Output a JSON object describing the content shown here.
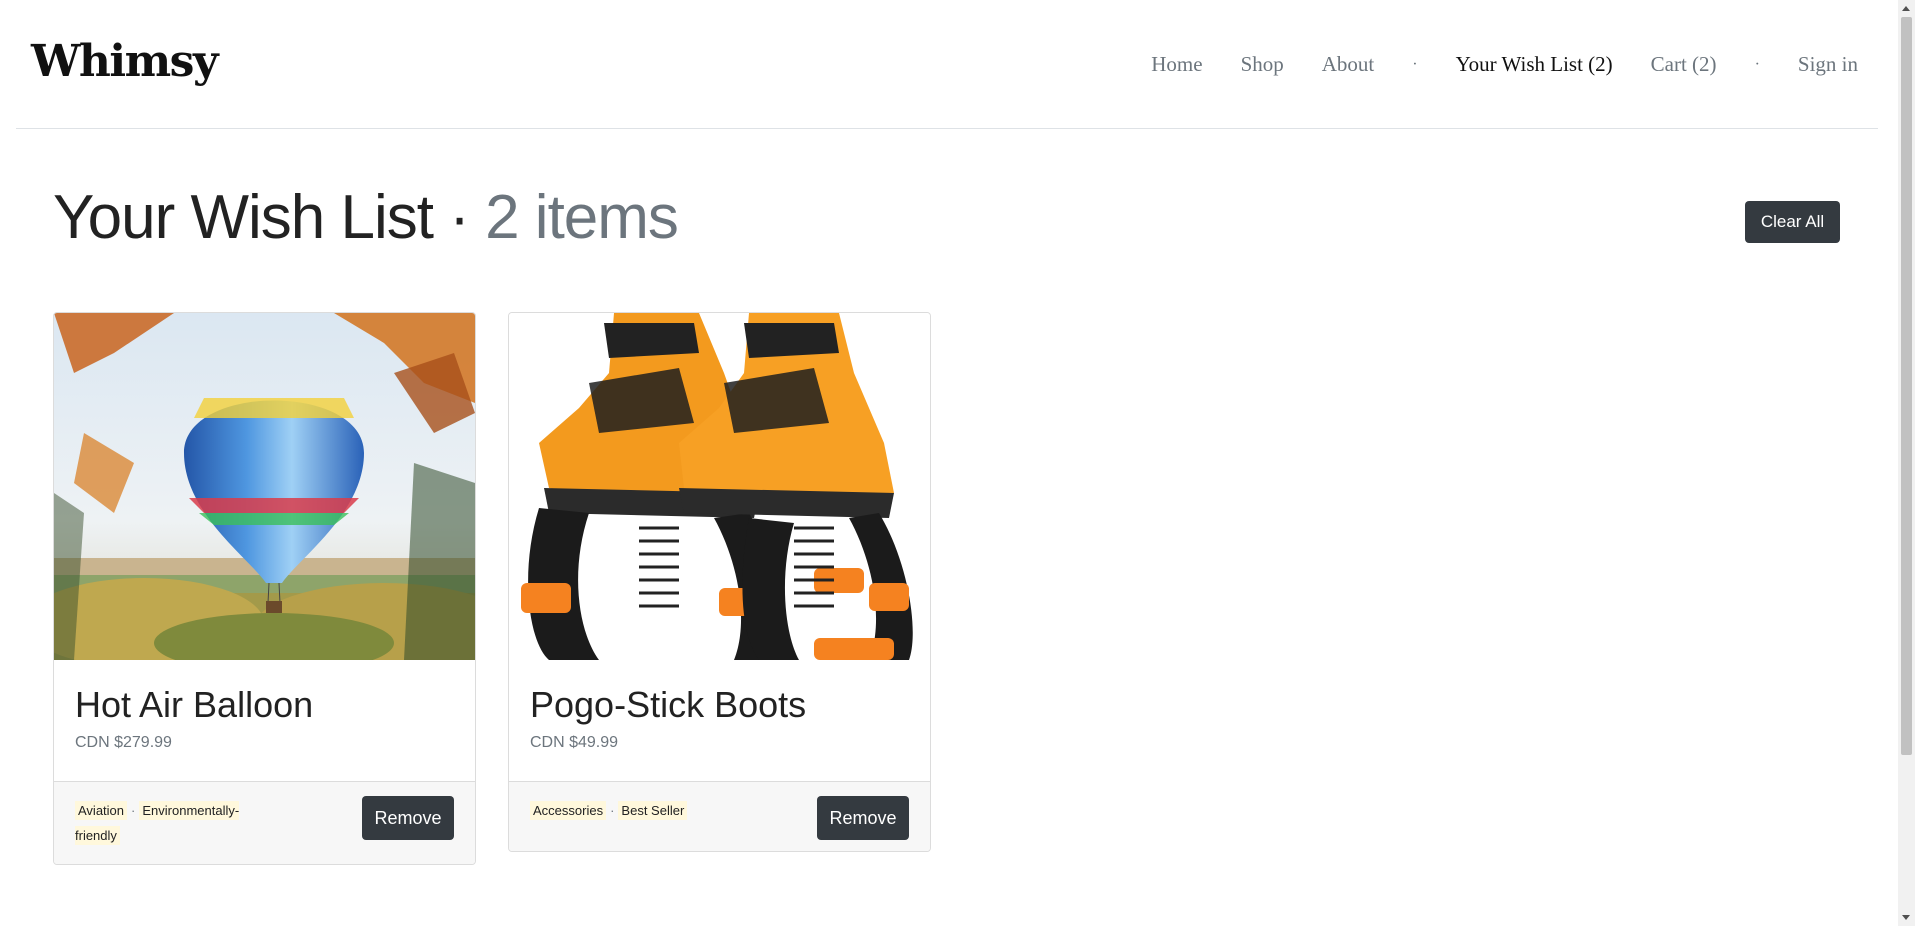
{
  "brand": "Whimsy",
  "nav": {
    "home": "Home",
    "shop": "Shop",
    "about": "About",
    "separator": "·",
    "wishlist": "Your Wish List (2)",
    "cart": "Cart (2)",
    "signin": "Sign in"
  },
  "heading": {
    "title": "Your Wish List ·",
    "count": "2 items"
  },
  "clear_all": "Clear All",
  "items": [
    {
      "title": "Hot Air Balloon",
      "price": "CDN $279.99",
      "tags": [
        "Aviation",
        "Environmentally-friendly"
      ],
      "remove": "Remove",
      "image": "hot-air-balloon-photo"
    },
    {
      "title": "Pogo-Stick Boots",
      "price": "CDN $49.99",
      "tags": [
        "Accessories",
        "Best Seller"
      ],
      "remove": "Remove",
      "image": "pogo-stick-boots-photo"
    }
  ],
  "colors": {
    "button_dark": "#343a40",
    "tag_bg": "#fff8dc",
    "muted": "#6c757d"
  }
}
